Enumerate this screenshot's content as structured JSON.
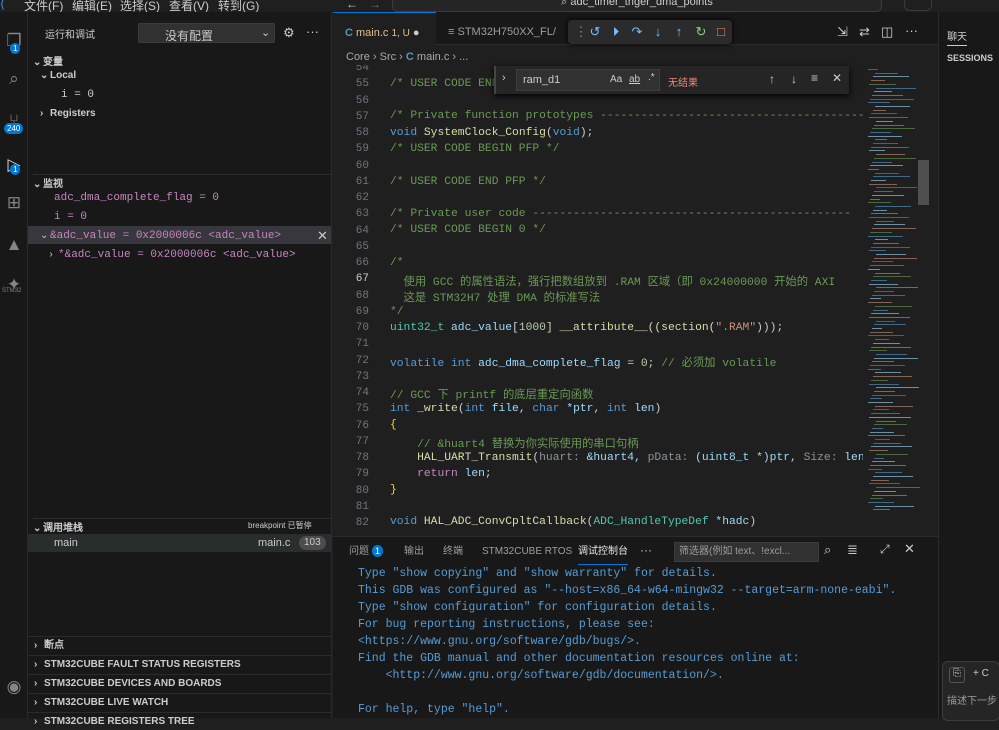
{
  "menu": [
    "文件(F)",
    "编辑(E)",
    "选择(S)",
    "查看(V)",
    "转到(G)"
  ],
  "search": {
    "text": "adc_timer_triger_dma_points"
  },
  "activity": {
    "badges": [
      "1",
      "240",
      "1"
    ],
    "accounts_label": "STM32"
  },
  "sidebar": {
    "title": "运行和调试",
    "config": "没有配置",
    "variables": {
      "title": "变量",
      "local": "Local",
      "local_var": "i = 0",
      "registers": "Registers"
    },
    "watch": {
      "title": "监视",
      "items": [
        "adc_dma_complete_flag = 0",
        "i = 0",
        "&adc_value = 0x2000006c <adc_value>",
        "*&adc_value = 0x2000006c <adc_value>"
      ]
    },
    "callstack": {
      "title": "调用堆栈",
      "status": "breakpoint 已暂停",
      "frame": "main",
      "file": "main.c",
      "line": "103"
    },
    "bottom": [
      "断点",
      "STM32CUBE FAULT STATUS REGISTERS",
      "STM32CUBE DEVICES AND BOARDS",
      "STM32CUBE LIVE WATCH",
      "STM32CUBE REGISTERS TREE"
    ]
  },
  "tabs": {
    "active": "main.c",
    "active_info": "1, U",
    "second": "STM32H750XX_FL/"
  },
  "breadcrumb": [
    "Core",
    "Src",
    "main.c",
    "..."
  ],
  "find": {
    "value": "ram_d1",
    "result": "无结果",
    "aa": "Aa",
    "ab": "ab"
  },
  "lines": [
    "54",
    "55",
    "56",
    "57",
    "58",
    "59",
    "60",
    "61",
    "62",
    "63",
    "64",
    "65",
    "66",
    "67",
    "68",
    "69",
    "70",
    "71",
    "72",
    "73",
    "74",
    "75",
    "76",
    "77",
    "78",
    "79",
    "80",
    "81",
    "82"
  ],
  "code": {
    "l55": "/* USER CODE END",
    "l57a": "/* Private function prototypes ---------------------------------------",
    "l58a": "void ",
    "l58b": "SystemClock_Config",
    "l58c": "(",
    "l58d": "void",
    "l58e": ");",
    "l59": "/* USER CODE BEGIN PFP */",
    "l61": "/* USER CODE END PFP */",
    "l63": "/* Private user code -----------------------------------------------",
    "l64": "/* USER CODE BEGIN 0 */",
    "l66": "/*",
    "l67": "  使用 GCC 的属性语法，强行把数组放到 .RAM 区域（即 0x24000000 开始的 AXI",
    "l68": "  这是 STM32H7 处理 DMA 的标准写法",
    "l69": "*/",
    "l70a": "uint32_t ",
    "l70b": "adc_value",
    "l70c": "[",
    "l70d": "1000",
    "l70e": "] __attribute__((section(",
    "l70f": "\".RAM\"",
    "l70g": ")));",
    "l72a": "volatile ",
    "l72b": "int ",
    "l72c": "adc_dma_complete_flag",
    "l72d": " = ",
    "l72e": "0",
    "l72f": "; ",
    "l72g": "// 必须加 volatile",
    "l74": "// GCC 下 printf 的底层重定向函数",
    "l75a": "int ",
    "l75b": "_write",
    "l75c": "(",
    "l75d": "int ",
    "l75e": "file",
    "l75f": ", ",
    "l75g": "char ",
    "l75h": "*ptr",
    "l75i": ", ",
    "l75j": "int ",
    "l75k": "len",
    ")": ")",
    "l76": "{",
    "l77": "    // &huart4 替换为你实际使用的串口句柄",
    "l78a": "    HAL_UART_Transmit",
    "l78b": "(",
    "l78c": "huart:",
    "l78d": " &huart4, ",
    "l78e": "pData:",
    "l78f": " (uint8_t *)ptr, ",
    "l78g": "Size:",
    "l78h": " len, T",
    "l79a": "    return ",
    "l79b": "len",
    ";": ";",
    "l80": "}",
    "l82a": "void ",
    "l82b": "HAL_ADC_ConvCpltCallback",
    "l82c": "(",
    "l82d": "ADC_HandleTypeDef ",
    "l82e": "*hadc",
    ")2": ")"
  },
  "panel": {
    "tabs": [
      "问题",
      "输出",
      "终端",
      "STM32CUBE RTOS",
      "调试控制台"
    ],
    "problems_count": "1",
    "filter_placeholder": "筛选器(例如 text、!excl...",
    "output": [
      "Type \"show copying\" and \"show warranty\" for details.",
      "This GDB was configured as \"--host=x86_64-w64-mingw32 --target=arm-none-eabi\".",
      "Type \"show configuration\" for configuration details.",
      "For bug reporting instructions, please see:",
      "<https://www.gnu.org/software/gdb/bugs/>.",
      "Find the GDB manual and other documentation resources online at:",
      "    <http://www.gnu.org/software/gdb/documentation/>.",
      "",
      "For help, type \"help\"."
    ]
  },
  "aux": {
    "chat": "聊天",
    "sessions": "SESSIONS",
    "describe": "描述下一步",
    "add": "+ C"
  }
}
